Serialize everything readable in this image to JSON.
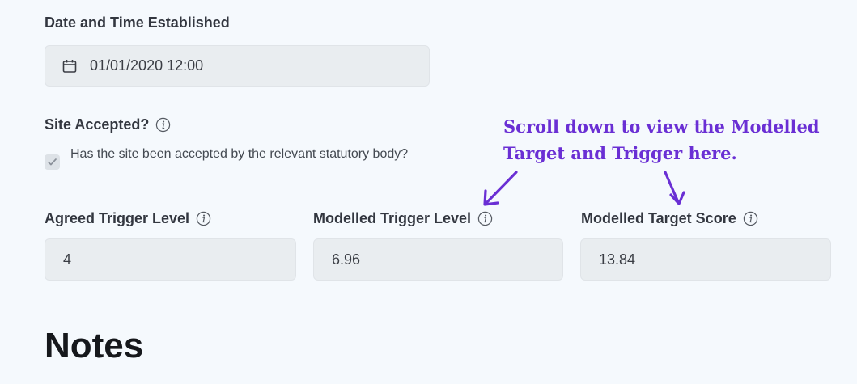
{
  "date_section": {
    "label": "Date and Time Established",
    "value": "01/01/2020 12:00",
    "icon": "calendar-icon"
  },
  "site_accepted": {
    "label": "Site Accepted?",
    "checkbox_text": "Has the site been accepted by the relevant statutory body?",
    "checked": true
  },
  "fields": [
    {
      "label": "Agreed Trigger Level",
      "value": "4"
    },
    {
      "label": "Modelled Trigger Level",
      "value": "6.96"
    },
    {
      "label": "Modelled Target Score",
      "value": "13.84"
    }
  ],
  "annotation": {
    "line1": "Scroll down to view the Modelled",
    "line2": "Target and Trigger here.",
    "color": "#6a2fd4"
  },
  "notes": {
    "heading": "Notes"
  },
  "colors": {
    "background": "#f5f9fd",
    "field_background": "#e9edf0"
  }
}
